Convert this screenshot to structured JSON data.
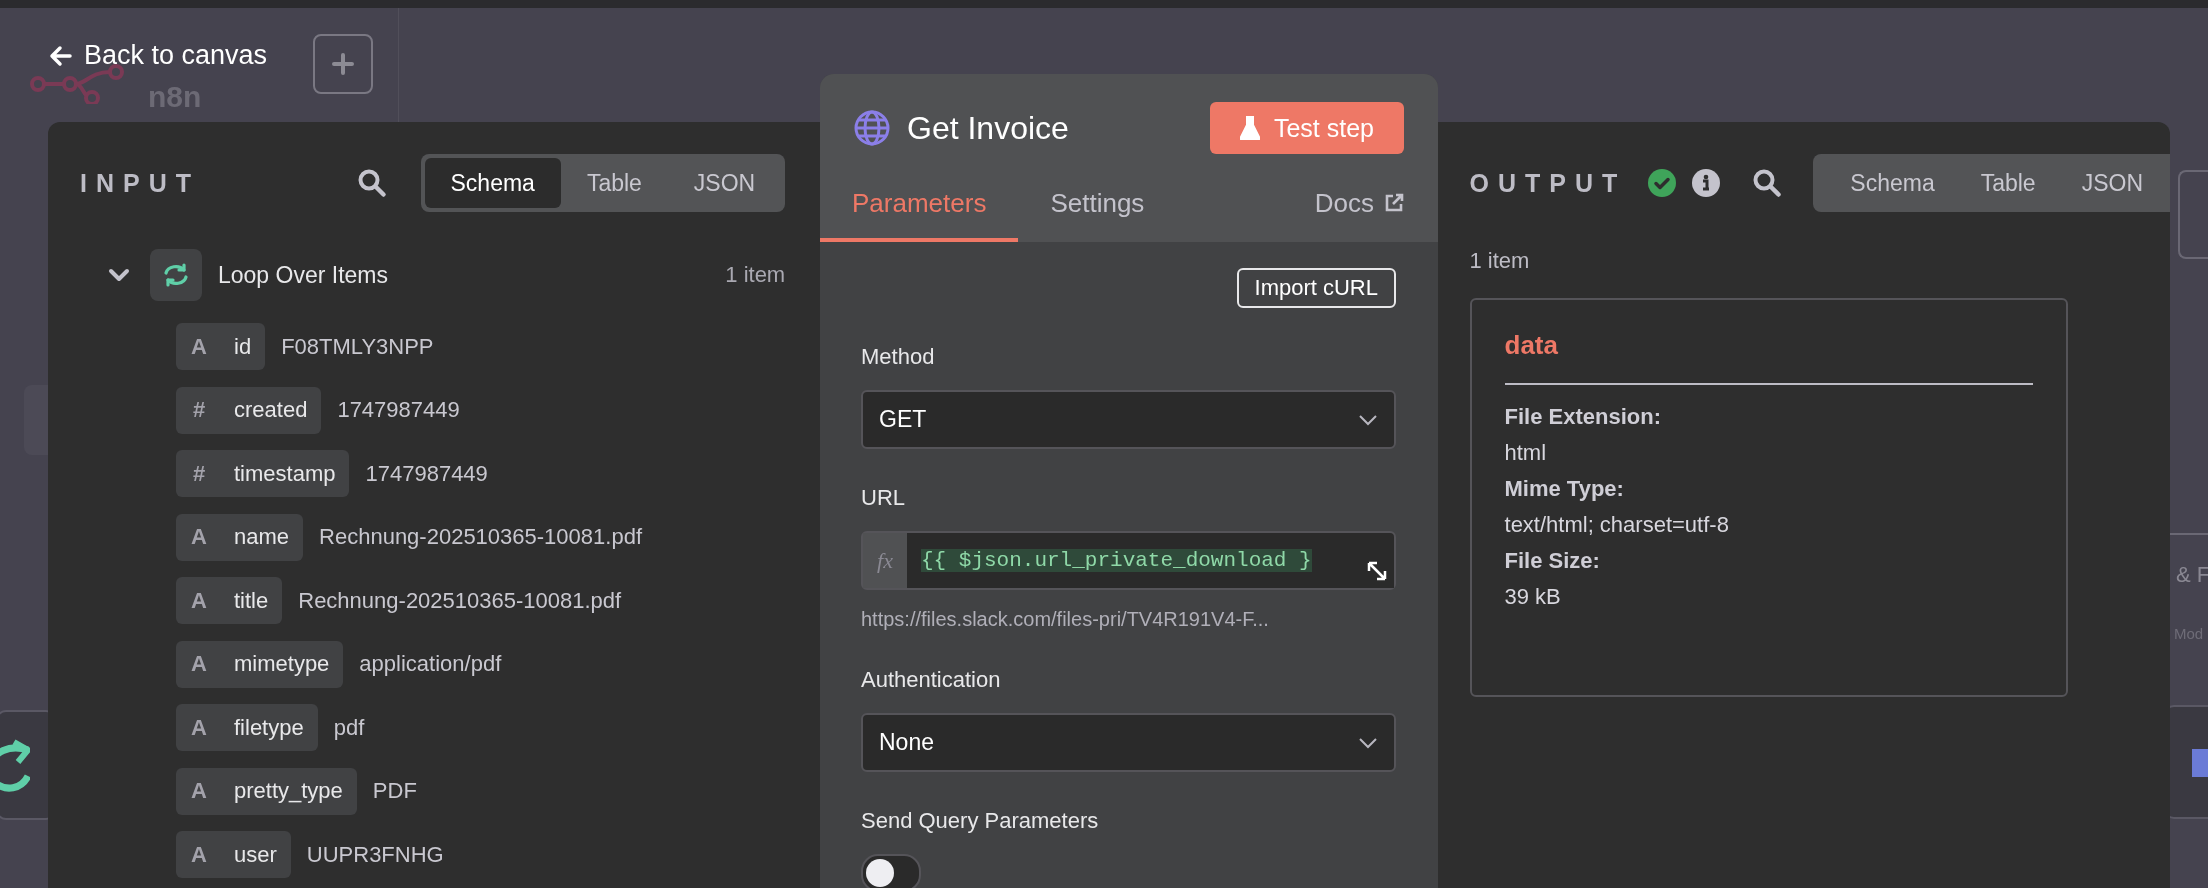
{
  "canvas": {
    "logo": "n8n",
    "fragments": [
      "& F",
      "Mod"
    ]
  },
  "back_link": {
    "label": "Back to canvas"
  },
  "input": {
    "title": "INPUT",
    "views": [
      {
        "label": "Schema",
        "selected": true
      },
      {
        "label": "Table",
        "selected": false
      },
      {
        "label": "JSON",
        "selected": false
      }
    ],
    "node": {
      "name": "Loop Over Items",
      "count": "1 item",
      "expanded": true
    },
    "fields": [
      {
        "type_mark": "A",
        "key": "id",
        "value": "F08TMLY3NPP"
      },
      {
        "type_mark": "#",
        "key": "created",
        "value": "1747987449"
      },
      {
        "type_mark": "#",
        "key": "timestamp",
        "value": "1747987449"
      },
      {
        "type_mark": "A",
        "key": "name",
        "value": "Rechnung-202510365-10081.pdf"
      },
      {
        "type_mark": "A",
        "key": "title",
        "value": "Rechnung-202510365-10081.pdf"
      },
      {
        "type_mark": "A",
        "key": "mimetype",
        "value": "application/pdf"
      },
      {
        "type_mark": "A",
        "key": "filetype",
        "value": "pdf"
      },
      {
        "type_mark": "A",
        "key": "pretty_type",
        "value": "PDF"
      },
      {
        "type_mark": "A",
        "key": "user",
        "value": "UUPR3FNHG"
      }
    ]
  },
  "node_panel": {
    "title": "Get Invoice",
    "test_button": "Test step",
    "tabs": [
      {
        "label": "Parameters",
        "selected": true
      },
      {
        "label": "Settings",
        "selected": false
      }
    ],
    "docs_link": "Docs",
    "import_button": "Import cURL",
    "params": [
      {
        "kind": "select",
        "label": "Method",
        "value": "GET"
      },
      {
        "kind": "expression",
        "label": "URL",
        "mark": "fx",
        "value": "{{ $json.url_private_download }",
        "hint": "https://files.slack.com/files-pri/TV4R191V4-F..."
      },
      {
        "kind": "select",
        "label": "Authentication",
        "value": "None"
      },
      {
        "kind": "toggle",
        "label": "Send Query Parameters",
        "on": false
      }
    ]
  },
  "output": {
    "title": "OUTPUT",
    "views": [
      {
        "label": "Schema",
        "selected": false
      },
      {
        "label": "Table",
        "selected": false
      },
      {
        "label": "JSON",
        "selected": false
      }
    ],
    "count": "1 item",
    "card": {
      "title": "data",
      "rows": [
        {
          "label": "File Extension:",
          "value": "html"
        },
        {
          "label": "Mime Type:",
          "value": "text/html; charset=utf-8"
        },
        {
          "label": "File Size:",
          "value": "39 kB"
        }
      ]
    }
  }
}
